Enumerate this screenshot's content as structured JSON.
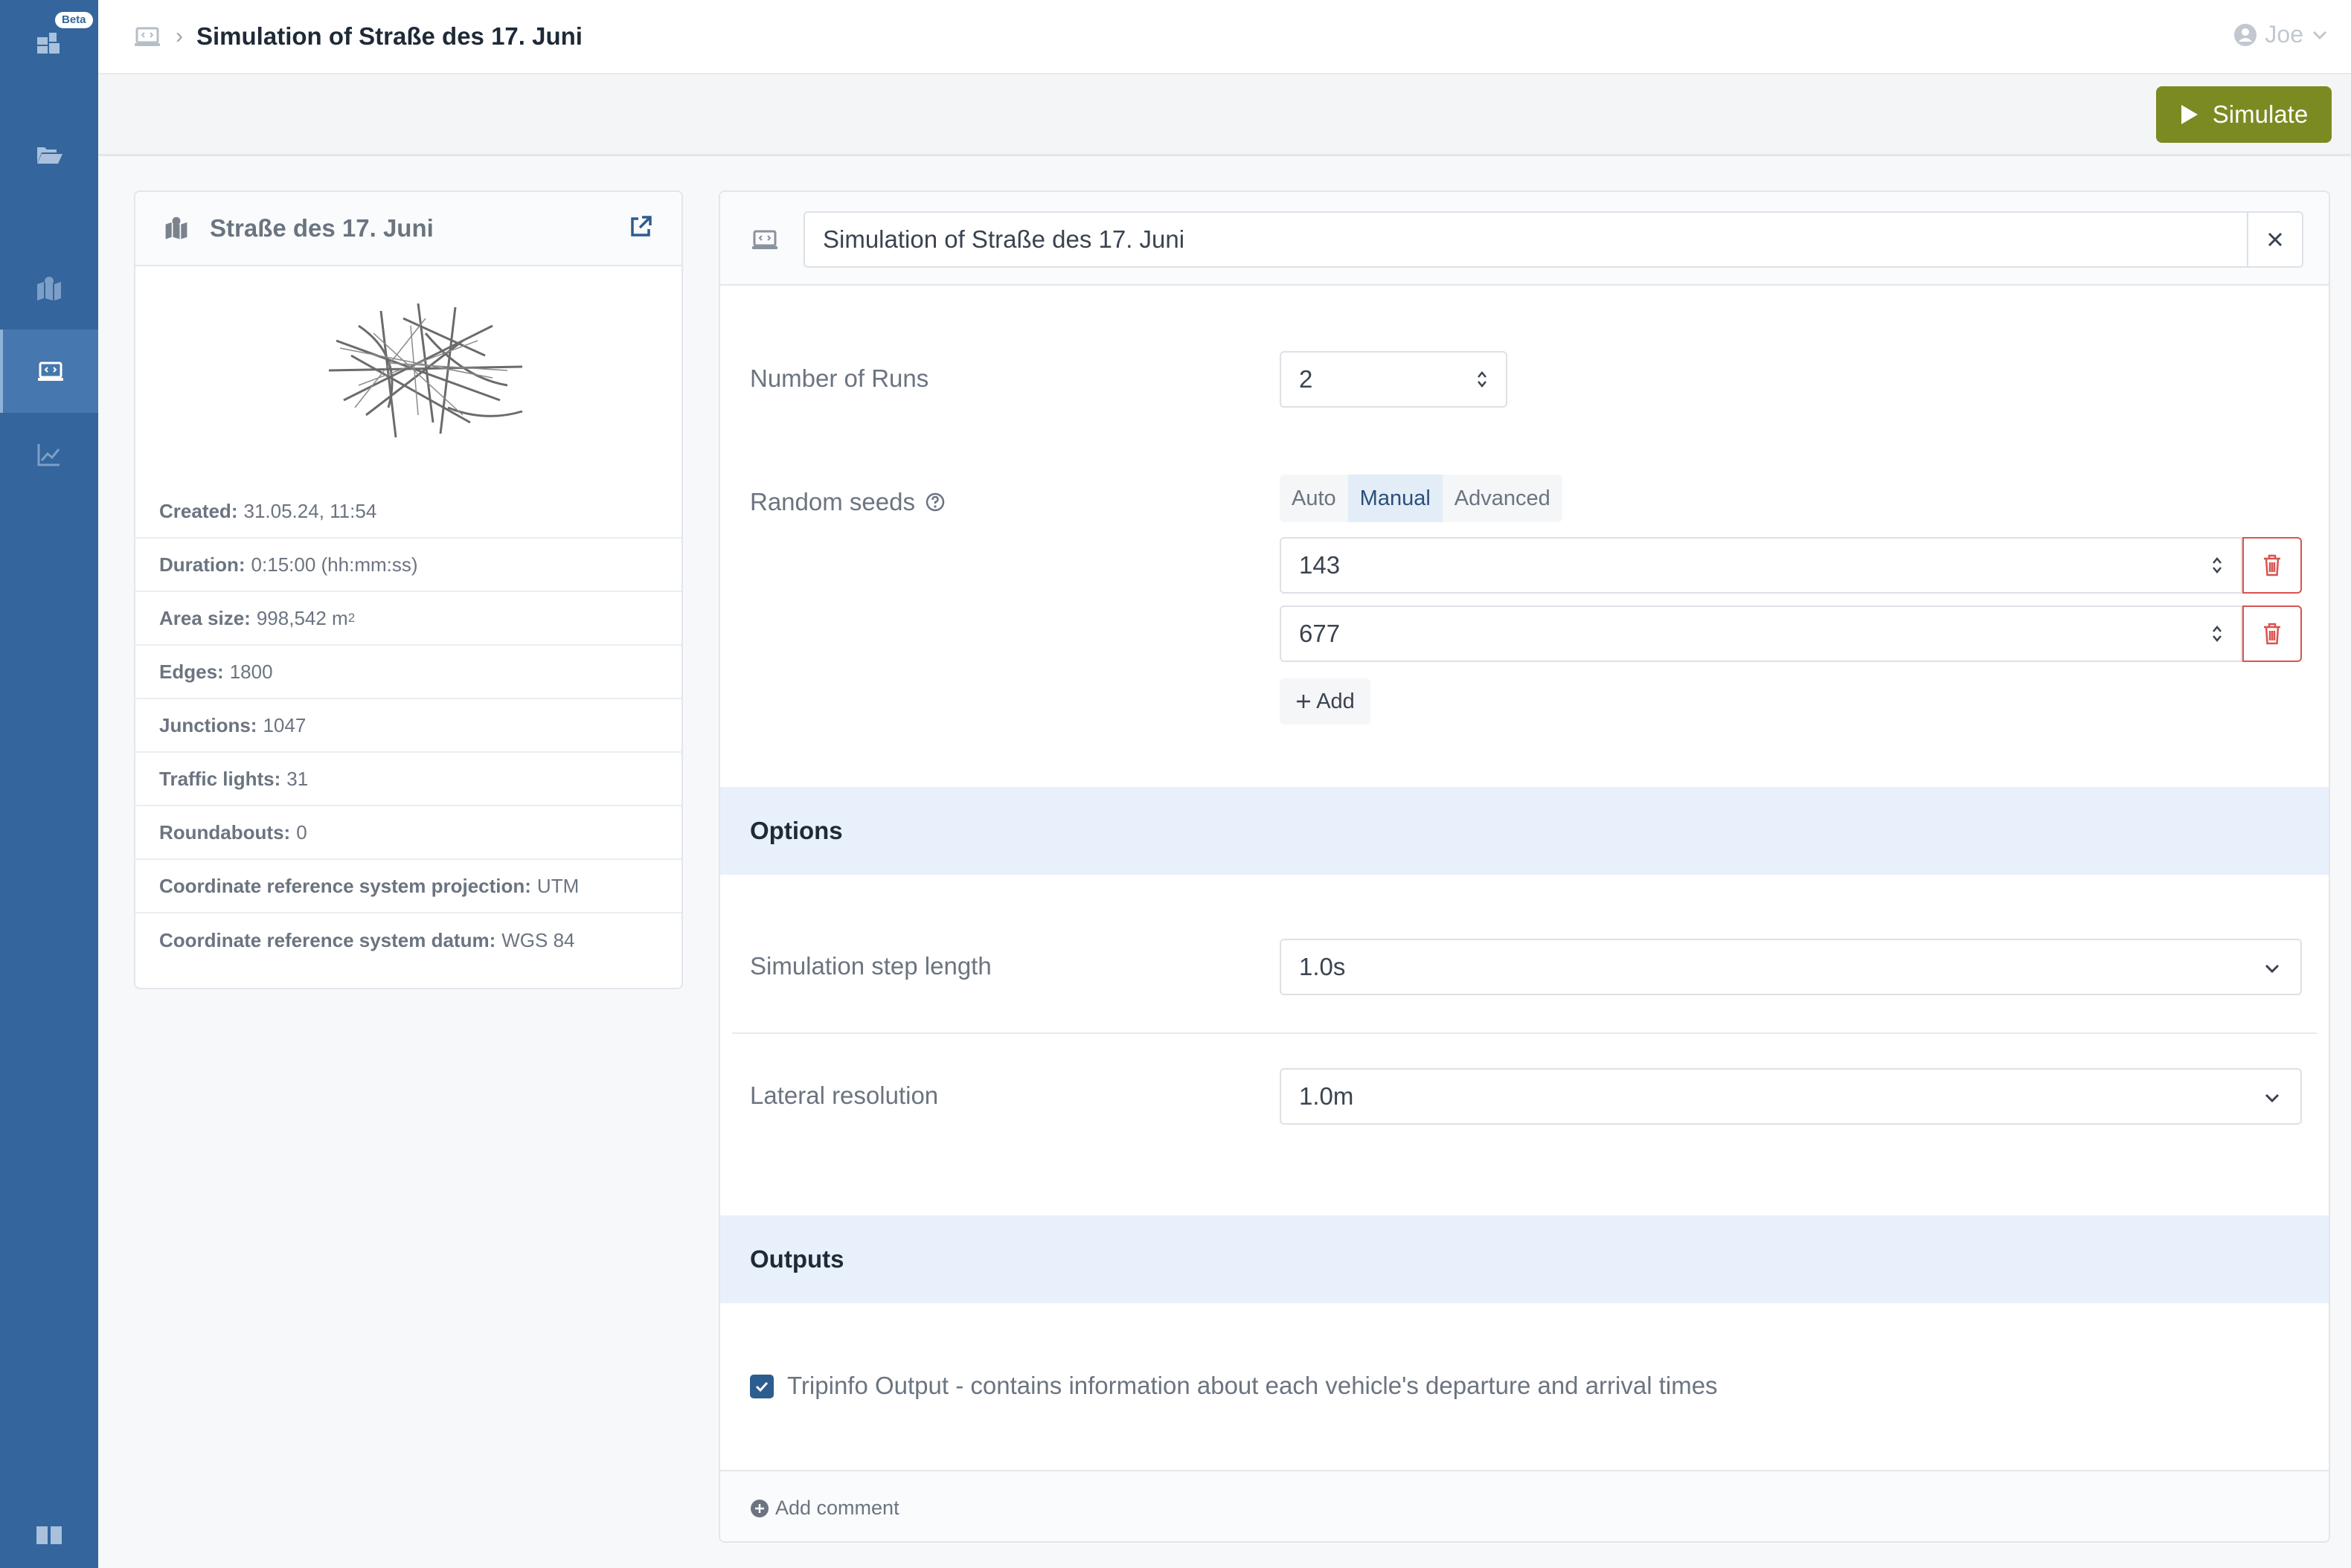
{
  "sidebar": {
    "badge": "Beta",
    "items": [
      {
        "icon": "dashboard-icon"
      },
      {
        "icon": "folder-open-icon"
      },
      {
        "icon": "map-icon"
      },
      {
        "icon": "simulation-icon",
        "active": true
      },
      {
        "icon": "chart-line-icon"
      },
      {
        "icon": "book-icon"
      }
    ]
  },
  "header": {
    "breadcrumb_icon": "simulation-icon",
    "title": "Simulation of Straße des 17. Juni",
    "user": "Joe"
  },
  "toolbar": {
    "simulate_label": "Simulate",
    "simulate_color": "#7c8a22"
  },
  "scenario": {
    "title": "Straße des 17. Juni",
    "info": [
      {
        "key": "Created:",
        "value": "31.05.24, 11:54"
      },
      {
        "key": "Duration:",
        "value": "0:15:00 (hh:mm:ss)"
      },
      {
        "key": "Area size:",
        "value": "998,542 m",
        "sup": "2"
      },
      {
        "key": "Edges:",
        "value": "1800"
      },
      {
        "key": "Junctions:",
        "value": "1047"
      },
      {
        "key": "Traffic lights:",
        "value": "31"
      },
      {
        "key": "Roundabouts:",
        "value": "0"
      },
      {
        "key": "Coordinate reference system projection:",
        "value": "UTM"
      },
      {
        "key": "Coordinate reference system datum:",
        "value": "WGS 84"
      }
    ]
  },
  "form": {
    "name_value": "Simulation of Straße des 17. Juni",
    "runs_label": "Number of Runs",
    "runs_value": "2",
    "seeds_label": "Random seeds",
    "seed_modes": [
      "Auto",
      "Manual",
      "Advanced"
    ],
    "seed_mode_selected": "Manual",
    "seeds": [
      "143",
      "677"
    ],
    "add_label": "Add",
    "options_heading": "Options",
    "step_label": "Simulation step length",
    "step_value": "1.0s",
    "lateral_label": "Lateral resolution",
    "lateral_value": "1.0m",
    "outputs_heading": "Outputs",
    "tripinfo_label": "Tripinfo Output - contains information about each vehicle's departure and arrival times",
    "tripinfo_checked": true,
    "add_comment_label": "Add comment"
  },
  "colors": {
    "sidebar": "#34659c",
    "section_bg": "#e8f0fb",
    "danger": "#d9534f"
  }
}
